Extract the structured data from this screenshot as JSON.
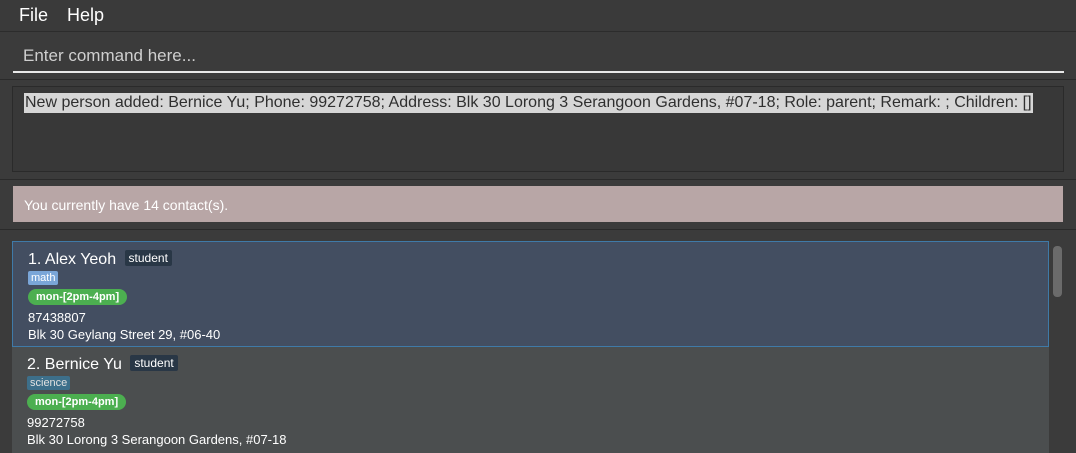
{
  "menu": {
    "file": "File",
    "help": "Help"
  },
  "command": {
    "placeholder": "Enter command here...",
    "value": ""
  },
  "result": {
    "text": "New person added: Bernice Yu; Phone: 99272758; Address: Blk 30 Lorong 3 Serangoon Gardens, #07-18; Role: parent; Remark: ; Children: []"
  },
  "status": {
    "text": "You currently have 14 contact(s)."
  },
  "contacts": [
    {
      "index": "1.",
      "name": "Alex Yeoh",
      "role": "student",
      "subject": "math",
      "subject_color": "#7aa6d8",
      "time": "mon-[2pm-4pm]",
      "phone": "87438807",
      "address": "Blk 30 Geylang Street 29, #06-40"
    },
    {
      "index": "2.",
      "name": "Bernice Yu",
      "role": "student",
      "subject": "science",
      "subject_color": "#3d6f8a",
      "time": "mon-[2pm-4pm]",
      "phone": "99272758",
      "address": "Blk 30 Lorong 3 Serangoon Gardens, #07-18"
    }
  ],
  "colors": {
    "accent_selected_border": "#3f7aa8",
    "status_bar": "#b8a6a6",
    "time_tag": "#4caf50",
    "role_tag": "#293746"
  }
}
